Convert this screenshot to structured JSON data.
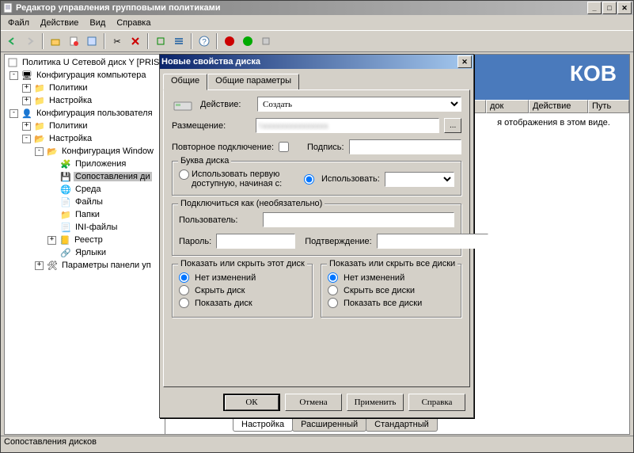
{
  "main": {
    "title": "Редактор управления групповыми политиками",
    "menu": [
      "Файл",
      "Действие",
      "Вид",
      "Справка"
    ],
    "status": "Сопоставления дисков"
  },
  "tree": {
    "root": "Политика U Сетевой диск Y [PRIS",
    "cfg_comp": "Конфигурация компьютера",
    "policies": "Политики",
    "settings": "Настройка",
    "cfg_user": "Конфигурация пользователя",
    "cfg_win": "Конфигурация Window",
    "apps": "Приложения",
    "drives": "Сопоставления ди",
    "env": "Среда",
    "files": "Файлы",
    "folders": "Папки",
    "ini": "INI-файлы",
    "registry": "Реестр",
    "shortcuts": "Ярлыки",
    "panel": "Параметры панели уп"
  },
  "right": {
    "banner_suffix": "КОВ",
    "cols": [
      "",
      "",
      "док",
      "Действие",
      "Путь"
    ],
    "empty": "я отображения в этом виде.",
    "tabs": [
      "Настройка",
      "Расширенный",
      "Стандартный"
    ]
  },
  "dlg": {
    "title": "Новые свойства диска",
    "tabs": [
      "Общие",
      "Общие параметры"
    ],
    "action_label": "Действие:",
    "action_value": "Создать",
    "location_label": "Размещение:",
    "location_value": "\\\\",
    "reconnect_label": "Повторное подключение:",
    "signature_label": "Подпись:",
    "drive_letter_group": "Буква диска",
    "use_first_available": "Использовать первую доступную, начиная с:",
    "use_specific": "Использовать:",
    "connect_as_group": "Подключиться как (необязательно)",
    "user_label": "Пользователь:",
    "pass_label": "Пароль:",
    "confirm_label": "Подтверждение:",
    "show_hide_this": "Показать или скрыть этот диск",
    "show_hide_all": "Показать или скрыть все диски",
    "no_change": "Нет изменений",
    "hide_this": "Скрыть диск",
    "show_this": "Показать диск",
    "hide_all": "Скрыть все диски",
    "show_all": "Показать все диски",
    "buttons": {
      "ok": "ОК",
      "cancel": "Отмена",
      "apply": "Применить",
      "help": "Справка"
    },
    "browse": "..."
  }
}
